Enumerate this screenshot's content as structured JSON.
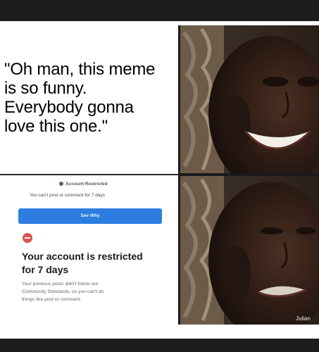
{
  "caption": {
    "line1": "\"Oh man, this meme",
    "line2": "is so funny.",
    "line3": "Everybody gonna",
    "line4": "love this one.\""
  },
  "notice": {
    "restricted_label": "Account Restricted",
    "cant_post": "You can't post or comment for 7 days",
    "see_why_label": "See Why",
    "title_line1": "Your account is restricted",
    "title_line2": "for 7 days",
    "desc_line1": "Your previous posts didn't follow our",
    "desc_line2": "Community Standards, so you can't do",
    "desc_line3": "things like post or comment."
  },
  "watermark": "Julian",
  "colors": {
    "button_blue": "#2d7de0",
    "warn_red": "#d9534f",
    "skin": "#2b1a14"
  },
  "images": {
    "top_right": "smiling-man-photo",
    "bottom_right": "disappointed-man-photo"
  }
}
